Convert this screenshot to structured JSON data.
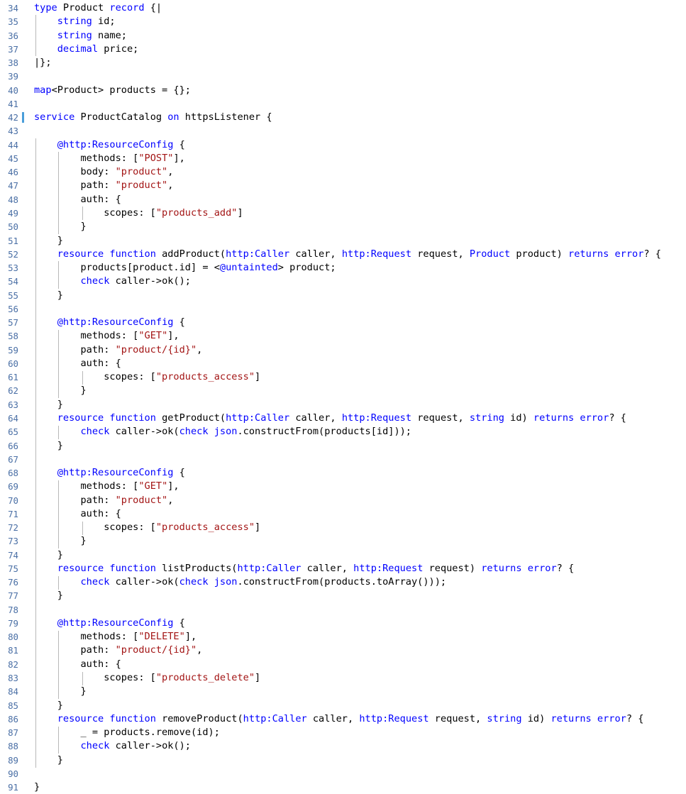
{
  "editor": {
    "language": "ballerina",
    "first_line": 34,
    "last_line": 91,
    "cursor_line": 42,
    "colors": {
      "background": "#ffffff",
      "foreground": "#000000",
      "keyword": "#0000ff",
      "string": "#a31515",
      "line_number": "#4a6fa5",
      "indent_guide": "#b8b8b8",
      "cursor_marker": "#4a9eda"
    }
  },
  "lines": [
    {
      "num": "34",
      "indent": 0,
      "tokens": [
        {
          "t": "type",
          "c": "kw"
        },
        {
          "t": " Product ",
          "c": "pl"
        },
        {
          "t": "record",
          "c": "kw"
        },
        {
          "t": " {|",
          "c": "pl"
        }
      ]
    },
    {
      "num": "35",
      "indent": 1,
      "tokens": [
        {
          "t": "    ",
          "c": "pl"
        },
        {
          "t": "string",
          "c": "kw"
        },
        {
          "t": " id;",
          "c": "pl"
        }
      ]
    },
    {
      "num": "36",
      "indent": 1,
      "tokens": [
        {
          "t": "    ",
          "c": "pl"
        },
        {
          "t": "string",
          "c": "kw"
        },
        {
          "t": " name;",
          "c": "pl"
        }
      ]
    },
    {
      "num": "37",
      "indent": 1,
      "tokens": [
        {
          "t": "    ",
          "c": "pl"
        },
        {
          "t": "decimal",
          "c": "kw"
        },
        {
          "t": " price;",
          "c": "pl"
        }
      ]
    },
    {
      "num": "38",
      "indent": 0,
      "tokens": [
        {
          "t": "|};",
          "c": "pl"
        }
      ]
    },
    {
      "num": "39",
      "indent": 0,
      "tokens": []
    },
    {
      "num": "40",
      "indent": 0,
      "tokens": [
        {
          "t": "map",
          "c": "kw"
        },
        {
          "t": "<Product> products = {};",
          "c": "pl"
        }
      ]
    },
    {
      "num": "41",
      "indent": 0,
      "tokens": []
    },
    {
      "num": "42",
      "indent": 0,
      "tokens": [
        {
          "t": "service",
          "c": "kw"
        },
        {
          "t": " ProductCatalog ",
          "c": "pl"
        },
        {
          "t": "on",
          "c": "kw"
        },
        {
          "t": " httpsListener {",
          "c": "pl"
        }
      ]
    },
    {
      "num": "43",
      "indent": 1,
      "tokens": []
    },
    {
      "num": "44",
      "indent": 1,
      "tokens": [
        {
          "t": "    ",
          "c": "pl"
        },
        {
          "t": "@http:ResourceConfig",
          "c": "kw"
        },
        {
          "t": " {",
          "c": "pl"
        }
      ]
    },
    {
      "num": "45",
      "indent": 2,
      "tokens": [
        {
          "t": "        methods: [",
          "c": "pl"
        },
        {
          "t": "\"POST\"",
          "c": "str"
        },
        {
          "t": "],",
          "c": "pl"
        }
      ]
    },
    {
      "num": "46",
      "indent": 2,
      "tokens": [
        {
          "t": "        body: ",
          "c": "pl"
        },
        {
          "t": "\"product\"",
          "c": "str"
        },
        {
          "t": ",",
          "c": "pl"
        }
      ]
    },
    {
      "num": "47",
      "indent": 2,
      "tokens": [
        {
          "t": "        path: ",
          "c": "pl"
        },
        {
          "t": "\"product\"",
          "c": "str"
        },
        {
          "t": ",",
          "c": "pl"
        }
      ]
    },
    {
      "num": "48",
      "indent": 2,
      "tokens": [
        {
          "t": "        auth: {",
          "c": "pl"
        }
      ]
    },
    {
      "num": "49",
      "indent": 3,
      "tokens": [
        {
          "t": "            scopes: [",
          "c": "pl"
        },
        {
          "t": "\"products_add\"",
          "c": "str"
        },
        {
          "t": "]",
          "c": "pl"
        }
      ]
    },
    {
      "num": "50",
      "indent": 2,
      "tokens": [
        {
          "t": "        }",
          "c": "pl"
        }
      ]
    },
    {
      "num": "51",
      "indent": 1,
      "tokens": [
        {
          "t": "    }",
          "c": "pl"
        }
      ]
    },
    {
      "num": "52",
      "indent": 1,
      "tokens": [
        {
          "t": "    ",
          "c": "pl"
        },
        {
          "t": "resource function",
          "c": "kw"
        },
        {
          "t": " addProduct(",
          "c": "pl"
        },
        {
          "t": "http:Caller",
          "c": "kw"
        },
        {
          "t": " caller, ",
          "c": "pl"
        },
        {
          "t": "http:Request",
          "c": "kw"
        },
        {
          "t": " request, ",
          "c": "pl"
        },
        {
          "t": "Product",
          "c": "kw"
        },
        {
          "t": " product) ",
          "c": "pl"
        },
        {
          "t": "returns error",
          "c": "kw"
        },
        {
          "t": "? {",
          "c": "pl"
        }
      ]
    },
    {
      "num": "53",
      "indent": 2,
      "tokens": [
        {
          "t": "        products[product.id] = <",
          "c": "pl"
        },
        {
          "t": "@untainted",
          "c": "kw"
        },
        {
          "t": "> product;",
          "c": "pl"
        }
      ]
    },
    {
      "num": "54",
      "indent": 2,
      "tokens": [
        {
          "t": "        ",
          "c": "pl"
        },
        {
          "t": "check",
          "c": "kw"
        },
        {
          "t": " caller->ok();",
          "c": "pl"
        }
      ]
    },
    {
      "num": "55",
      "indent": 1,
      "tokens": [
        {
          "t": "    }",
          "c": "pl"
        }
      ]
    },
    {
      "num": "56",
      "indent": 1,
      "tokens": []
    },
    {
      "num": "57",
      "indent": 1,
      "tokens": [
        {
          "t": "    ",
          "c": "pl"
        },
        {
          "t": "@http:ResourceConfig",
          "c": "kw"
        },
        {
          "t": " {",
          "c": "pl"
        }
      ]
    },
    {
      "num": "58",
      "indent": 2,
      "tokens": [
        {
          "t": "        methods: [",
          "c": "pl"
        },
        {
          "t": "\"GET\"",
          "c": "str"
        },
        {
          "t": "],",
          "c": "pl"
        }
      ]
    },
    {
      "num": "59",
      "indent": 2,
      "tokens": [
        {
          "t": "        path: ",
          "c": "pl"
        },
        {
          "t": "\"product/{id}\"",
          "c": "str"
        },
        {
          "t": ",",
          "c": "pl"
        }
      ]
    },
    {
      "num": "60",
      "indent": 2,
      "tokens": [
        {
          "t": "        auth: {",
          "c": "pl"
        }
      ]
    },
    {
      "num": "61",
      "indent": 3,
      "tokens": [
        {
          "t": "            scopes: [",
          "c": "pl"
        },
        {
          "t": "\"products_access\"",
          "c": "str"
        },
        {
          "t": "]",
          "c": "pl"
        }
      ]
    },
    {
      "num": "62",
      "indent": 2,
      "tokens": [
        {
          "t": "        }",
          "c": "pl"
        }
      ]
    },
    {
      "num": "63",
      "indent": 1,
      "tokens": [
        {
          "t": "    }",
          "c": "pl"
        }
      ]
    },
    {
      "num": "64",
      "indent": 1,
      "tokens": [
        {
          "t": "    ",
          "c": "pl"
        },
        {
          "t": "resource function",
          "c": "kw"
        },
        {
          "t": " getProduct(",
          "c": "pl"
        },
        {
          "t": "http:Caller",
          "c": "kw"
        },
        {
          "t": " caller, ",
          "c": "pl"
        },
        {
          "t": "http:Request",
          "c": "kw"
        },
        {
          "t": " request, ",
          "c": "pl"
        },
        {
          "t": "string",
          "c": "kw"
        },
        {
          "t": " id) ",
          "c": "pl"
        },
        {
          "t": "returns error",
          "c": "kw"
        },
        {
          "t": "? {",
          "c": "pl"
        }
      ]
    },
    {
      "num": "65",
      "indent": 2,
      "tokens": [
        {
          "t": "        ",
          "c": "pl"
        },
        {
          "t": "check",
          "c": "kw"
        },
        {
          "t": " caller->ok(",
          "c": "pl"
        },
        {
          "t": "check json",
          "c": "kw"
        },
        {
          "t": ".constructFrom(products[id]));",
          "c": "pl"
        }
      ]
    },
    {
      "num": "66",
      "indent": 1,
      "tokens": [
        {
          "t": "    }",
          "c": "pl"
        }
      ]
    },
    {
      "num": "67",
      "indent": 1,
      "tokens": []
    },
    {
      "num": "68",
      "indent": 1,
      "tokens": [
        {
          "t": "    ",
          "c": "pl"
        },
        {
          "t": "@http:ResourceConfig",
          "c": "kw"
        },
        {
          "t": " {",
          "c": "pl"
        }
      ]
    },
    {
      "num": "69",
      "indent": 2,
      "tokens": [
        {
          "t": "        methods: [",
          "c": "pl"
        },
        {
          "t": "\"GET\"",
          "c": "str"
        },
        {
          "t": "],",
          "c": "pl"
        }
      ]
    },
    {
      "num": "70",
      "indent": 2,
      "tokens": [
        {
          "t": "        path: ",
          "c": "pl"
        },
        {
          "t": "\"product\"",
          "c": "str"
        },
        {
          "t": ",",
          "c": "pl"
        }
      ]
    },
    {
      "num": "71",
      "indent": 2,
      "tokens": [
        {
          "t": "        auth: {",
          "c": "pl"
        }
      ]
    },
    {
      "num": "72",
      "indent": 3,
      "tokens": [
        {
          "t": "            scopes: [",
          "c": "pl"
        },
        {
          "t": "\"products_access\"",
          "c": "str"
        },
        {
          "t": "]",
          "c": "pl"
        }
      ]
    },
    {
      "num": "73",
      "indent": 2,
      "tokens": [
        {
          "t": "        }",
          "c": "pl"
        }
      ]
    },
    {
      "num": "74",
      "indent": 1,
      "tokens": [
        {
          "t": "    }",
          "c": "pl"
        }
      ]
    },
    {
      "num": "75",
      "indent": 1,
      "tokens": [
        {
          "t": "    ",
          "c": "pl"
        },
        {
          "t": "resource function",
          "c": "kw"
        },
        {
          "t": " listProducts(",
          "c": "pl"
        },
        {
          "t": "http:Caller",
          "c": "kw"
        },
        {
          "t": " caller, ",
          "c": "pl"
        },
        {
          "t": "http:Request",
          "c": "kw"
        },
        {
          "t": " request) ",
          "c": "pl"
        },
        {
          "t": "returns error",
          "c": "kw"
        },
        {
          "t": "? {",
          "c": "pl"
        }
      ]
    },
    {
      "num": "76",
      "indent": 2,
      "tokens": [
        {
          "t": "        ",
          "c": "pl"
        },
        {
          "t": "check",
          "c": "kw"
        },
        {
          "t": " caller->ok(",
          "c": "pl"
        },
        {
          "t": "check json",
          "c": "kw"
        },
        {
          "t": ".constructFrom(products.toArray()));",
          "c": "pl"
        }
      ]
    },
    {
      "num": "77",
      "indent": 1,
      "tokens": [
        {
          "t": "    }",
          "c": "pl"
        }
      ]
    },
    {
      "num": "78",
      "indent": 1,
      "tokens": []
    },
    {
      "num": "79",
      "indent": 1,
      "tokens": [
        {
          "t": "    ",
          "c": "pl"
        },
        {
          "t": "@http:ResourceConfig",
          "c": "kw"
        },
        {
          "t": " {",
          "c": "pl"
        }
      ]
    },
    {
      "num": "80",
      "indent": 2,
      "tokens": [
        {
          "t": "        methods: [",
          "c": "pl"
        },
        {
          "t": "\"DELETE\"",
          "c": "str"
        },
        {
          "t": "],",
          "c": "pl"
        }
      ]
    },
    {
      "num": "81",
      "indent": 2,
      "tokens": [
        {
          "t": "        path: ",
          "c": "pl"
        },
        {
          "t": "\"product/{id}\"",
          "c": "str"
        },
        {
          "t": ",",
          "c": "pl"
        }
      ]
    },
    {
      "num": "82",
      "indent": 2,
      "tokens": [
        {
          "t": "        auth: {",
          "c": "pl"
        }
      ]
    },
    {
      "num": "83",
      "indent": 3,
      "tokens": [
        {
          "t": "            scopes: [",
          "c": "pl"
        },
        {
          "t": "\"products_delete\"",
          "c": "str"
        },
        {
          "t": "]",
          "c": "pl"
        }
      ]
    },
    {
      "num": "84",
      "indent": 2,
      "tokens": [
        {
          "t": "        }",
          "c": "pl"
        }
      ]
    },
    {
      "num": "85",
      "indent": 1,
      "tokens": [
        {
          "t": "    }",
          "c": "pl"
        }
      ]
    },
    {
      "num": "86",
      "indent": 1,
      "tokens": [
        {
          "t": "    ",
          "c": "pl"
        },
        {
          "t": "resource function",
          "c": "kw"
        },
        {
          "t": " removeProduct(",
          "c": "pl"
        },
        {
          "t": "http:Caller",
          "c": "kw"
        },
        {
          "t": " caller, ",
          "c": "pl"
        },
        {
          "t": "http:Request",
          "c": "kw"
        },
        {
          "t": " request, ",
          "c": "pl"
        },
        {
          "t": "string",
          "c": "kw"
        },
        {
          "t": " id) ",
          "c": "pl"
        },
        {
          "t": "returns error",
          "c": "kw"
        },
        {
          "t": "? {",
          "c": "pl"
        }
      ]
    },
    {
      "num": "87",
      "indent": 2,
      "tokens": [
        {
          "t": "        _ = products.remove(id);",
          "c": "pl"
        }
      ]
    },
    {
      "num": "88",
      "indent": 2,
      "tokens": [
        {
          "t": "        ",
          "c": "pl"
        },
        {
          "t": "check",
          "c": "kw"
        },
        {
          "t": " caller->ok();",
          "c": "pl"
        }
      ]
    },
    {
      "num": "89",
      "indent": 1,
      "tokens": [
        {
          "t": "    }",
          "c": "pl"
        }
      ]
    },
    {
      "num": "90",
      "indent": 0,
      "tokens": []
    },
    {
      "num": "91",
      "indent": 0,
      "tokens": [
        {
          "t": "}",
          "c": "pl"
        }
      ]
    }
  ]
}
